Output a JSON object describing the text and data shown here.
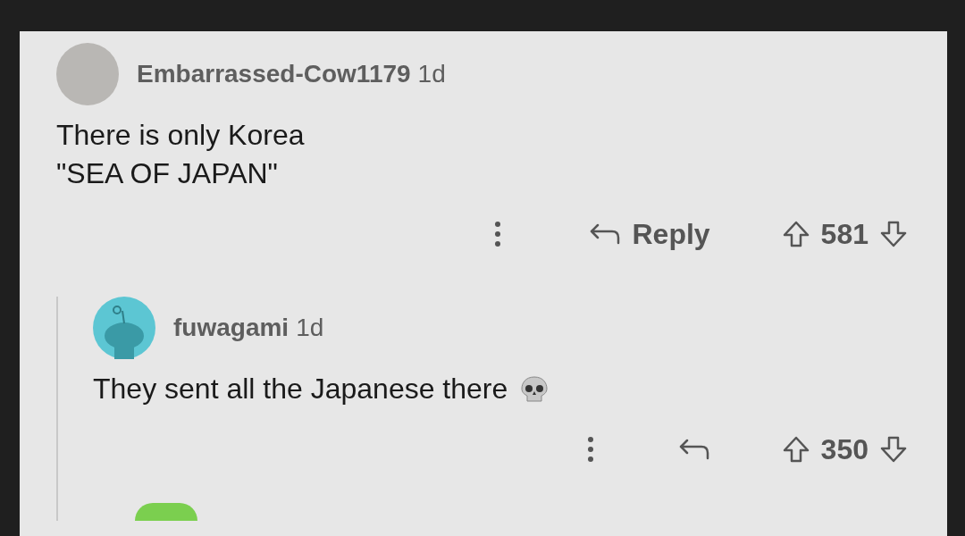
{
  "comments": [
    {
      "author": "Embarrassed-Cow1179",
      "age": "1d",
      "avatar": {
        "kind": "photo"
      },
      "body": [
        "There is only Korea",
        "\"SEA OF JAPAN\""
      ],
      "reply_label": "Reply",
      "score": "581",
      "emoji": false,
      "children": [
        {
          "author": "fuwagami",
          "age": "1d",
          "avatar": {
            "kind": "default"
          },
          "body": [
            "They sent all the Japanese there"
          ],
          "score": "350",
          "emoji": true
        }
      ]
    }
  ]
}
